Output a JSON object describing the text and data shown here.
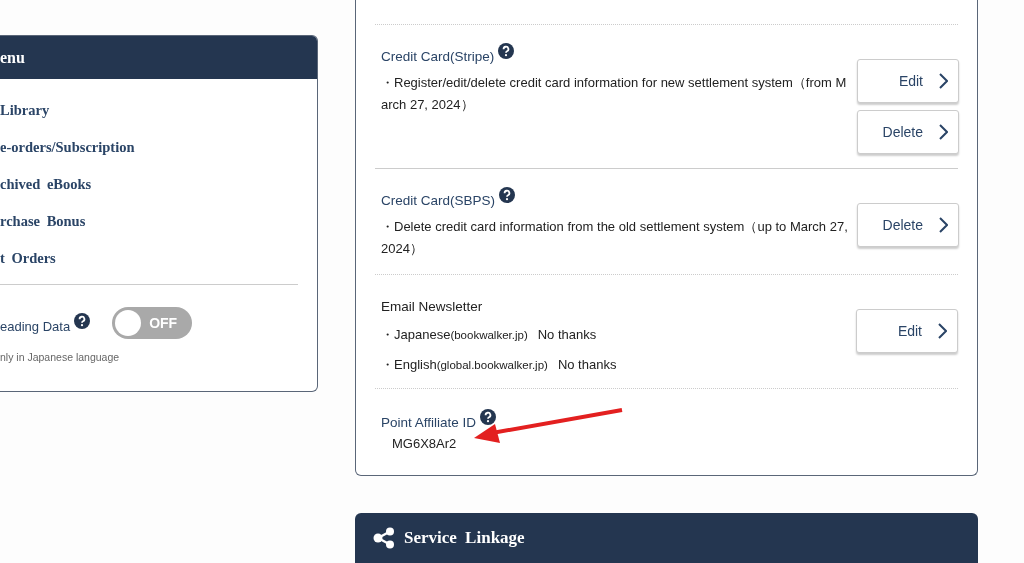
{
  "menu": {
    "title": "enu",
    "items": [
      {
        "label": "Library"
      },
      {
        "label": "e-orders/Subscription"
      },
      {
        "label": "chived eBooks"
      },
      {
        "label": "rchase Bonus"
      },
      {
        "label": "t Orders"
      }
    ],
    "reading_data": {
      "label": "eading Data",
      "toggle": {
        "on": false,
        "label": "OFF"
      },
      "note": "nly in Japanese language"
    }
  },
  "settings": [
    {
      "kind": "buttons",
      "title": "Credit Card(Stripe)",
      "help": true,
      "lines": [
        {
          "text": "・Register/edit/delete credit card information for new settlement system（from March 27, 2024）"
        }
      ],
      "buttons": [
        "Edit",
        "Delete"
      ]
    },
    {
      "kind": "buttons",
      "title": "Credit Card(SBPS)",
      "help": true,
      "lines": [
        {
          "text": "・Delete credit card information from the old settlement system（up to March 27, 2024）"
        }
      ],
      "buttons": [
        "Delete"
      ]
    },
    {
      "kind": "newsletter",
      "title": "Email Newsletter",
      "help": false,
      "lines": [
        {
          "text": "・Japanese",
          "site": "(bookwalker.jp)",
          "value": "No thanks"
        },
        {
          "text": "・English",
          "site": "(global.bookwalker.jp)",
          "value": "No thanks"
        }
      ],
      "buttons": [
        "Edit"
      ]
    },
    {
      "kind": "id",
      "title": "Point Affiliate ID",
      "help": true,
      "value": "MG6X8Ar2"
    }
  ],
  "service_linkage": {
    "title": "Service Linkage"
  }
}
